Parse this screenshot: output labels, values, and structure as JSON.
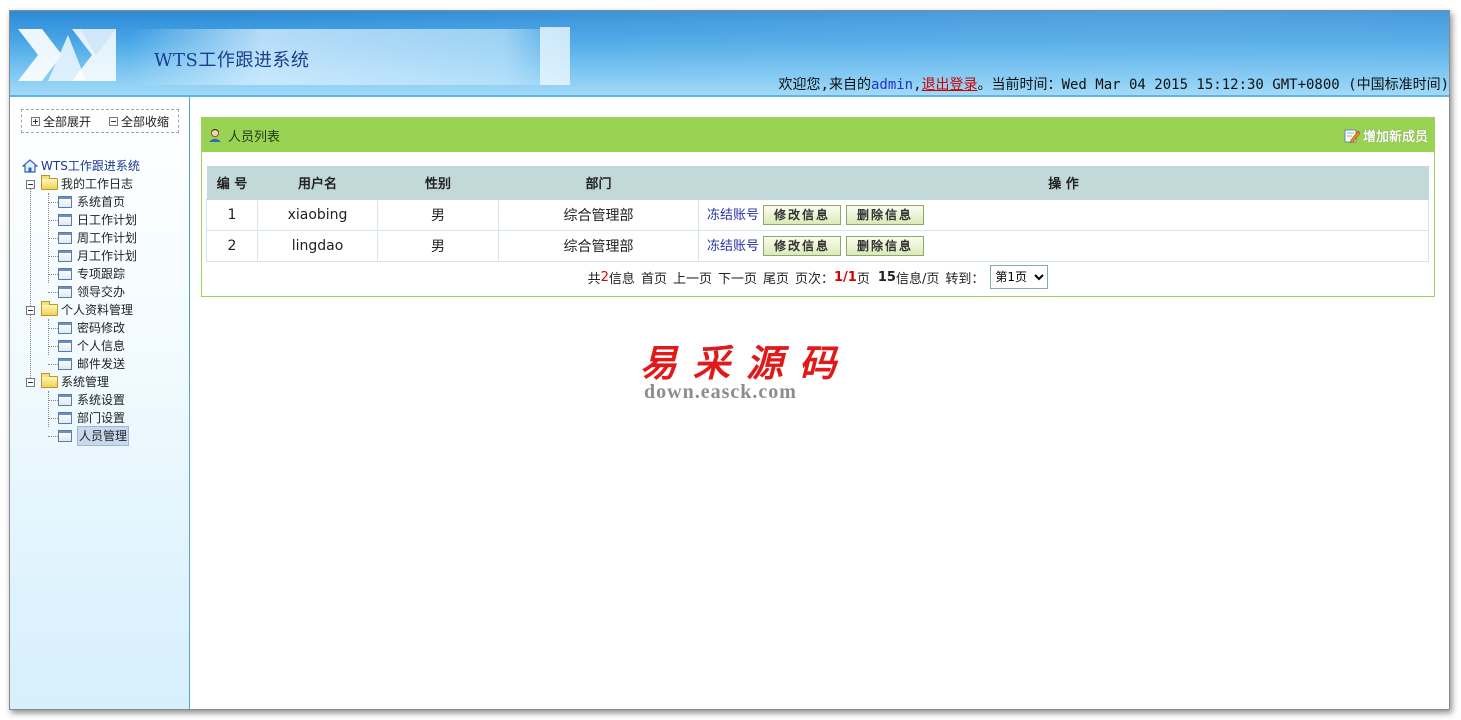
{
  "header": {
    "system_title": "WTS工作跟进系统",
    "welcome_prefix": "欢迎您,来自的",
    "username": "admin",
    "comma": ",",
    "logout_label": "退出登录",
    "time_prefix": "。当前时间：",
    "current_time": "Wed Mar 04 2015 15:12:30 GMT+0800 (中国标准时间)"
  },
  "sidebar": {
    "expand_all": "全部展开",
    "collapse_all": "全部收缩",
    "root": "WTS工作跟进系统",
    "groups": [
      {
        "label": "我的工作日志",
        "items": [
          "系统首页",
          "日工作计划",
          "周工作计划",
          "月工作计划",
          "专项跟踪",
          "领导交办"
        ]
      },
      {
        "label": "个人资料管理",
        "items": [
          "密码修改",
          "个人信息",
          "邮件发送"
        ]
      },
      {
        "label": "系统管理",
        "items": [
          "系统设置",
          "部门设置",
          "人员管理"
        ]
      }
    ],
    "selected_item": "人员管理"
  },
  "panel": {
    "title": "人员列表",
    "add_member_label": "增加新成员",
    "columns": [
      "编 号",
      "用户名",
      "性别",
      "部门",
      "操 作"
    ],
    "rows": [
      {
        "id": "1",
        "username": "xiaobing",
        "gender": "男",
        "department": "综合管理部"
      },
      {
        "id": "2",
        "username": "lingdao",
        "gender": "男",
        "department": "综合管理部"
      }
    ],
    "actions": {
      "freeze": "冻结账号",
      "edit": "修改信息",
      "delete": "删除信息"
    }
  },
  "pager": {
    "total_prefix": "共",
    "total_count": "2",
    "total_suffix": "信息",
    "first": "首页",
    "prev": "上一页",
    "next": "下一页",
    "last": "尾页",
    "page_label": "页次：",
    "current_page": "1/1",
    "page_unit": "页",
    "per_page": "15",
    "per_page_suffix": "信息/页",
    "goto_label": "转到：",
    "select_value": "第1页"
  },
  "watermark": {
    "title": "易采源码",
    "url": "down.easck.com"
  },
  "colors": {
    "header_blue": "#48a6e6",
    "panel_green": "#9ad253",
    "table_header": "#c3d9d9",
    "link_blue": "#2633a8",
    "logout_red": "#cc0000",
    "watermark_red": "#e01a1a"
  },
  "icons": [
    "logo-icon",
    "home-icon",
    "folder-icon",
    "page-icon",
    "person-icon",
    "edit-icon",
    "chevron-down-icon"
  ]
}
